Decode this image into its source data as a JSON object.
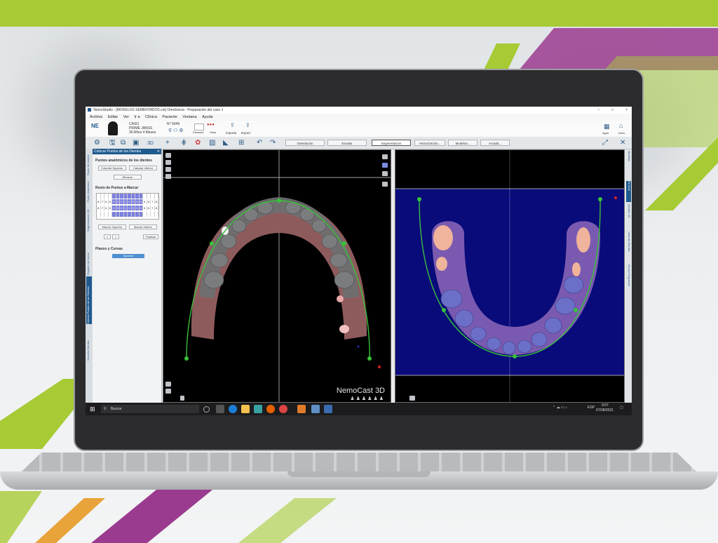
{
  "window": {
    "title": "NemoStudio - [MODELOS SEMENTADOS.cst] Ortodoncia - Preparación del caso 1",
    "minimize": "–",
    "maximize": "□",
    "close": "×"
  },
  "menu": [
    "Archivo",
    "Editar",
    "Ver",
    "Ir a",
    "Clínica",
    "Paciente",
    "Ventana",
    "Ayuda"
  ],
  "case": {
    "logo": "NE",
    "case_label": "CASO",
    "patient_name": "PRIME JANSS",
    "age": "30 Años 4 Meses",
    "number": "N° 6049",
    "tools_label": "Paciente",
    "views_label": "Vista",
    "import_label": "Importa",
    "export_label": "Export",
    "app_label": "Apps",
    "home_label": "Inicio"
  },
  "toolbar": {
    "buttons": [
      "Orientación",
      "Escalar",
      "Segmentación",
      "Vectorización...",
      "Modelos...",
      "Arcada..."
    ],
    "active_index": 2
  },
  "left_tabs": [
    "Punto de Interés",
    "Punto anatómico",
    "Segmentación 3D",
    "Registro de Arcos",
    "Colocar Puntos de los Dientes",
    "Sección Dientes"
  ],
  "right_tabs": [
    "Medidas",
    "Rx Oral",
    "Modelo 3D",
    "Vista de Dientes",
    "Grosor Esqueleto"
  ],
  "panel": {
    "header": "Colocar Puntos de los Dientes",
    "section1": "Puntos anatómicos de los dientes",
    "btn_upper": "Calcular Superior",
    "btn_lower": "Calcular Inferior",
    "btn_clear": "Eliminar",
    "section2": "Resto de Puntos a Marcar",
    "teeth_upper": [
      "8",
      "7",
      "6",
      "5",
      "4",
      "3",
      "2",
      "1",
      "1",
      "2",
      "3",
      "4",
      "5",
      "6",
      "7",
      "8"
    ],
    "teeth_lower": [
      "8",
      "7",
      "6",
      "5",
      "4",
      "3",
      "2",
      "1",
      "1",
      "2",
      "3",
      "4",
      "5",
      "6",
      "7",
      "8"
    ],
    "mark_upper": "Marcar Superior",
    "mark_lower": "Marcar Inferior",
    "finish": "Finalizar",
    "section3": "Planos y Curvas",
    "superior_btn": "Superior"
  },
  "viewport": {
    "brand": "NemoCast 3D"
  },
  "taskbar": {
    "search_placeholder": "Buscar",
    "language": "ESP",
    "time": "9:07",
    "date": "07/08/2021"
  },
  "colors": {
    "accent": "#1f5a8e",
    "brand_green": "#a6cb35",
    "brand_purple": "#9b3b8f",
    "arch_curve": "#38c13a"
  }
}
